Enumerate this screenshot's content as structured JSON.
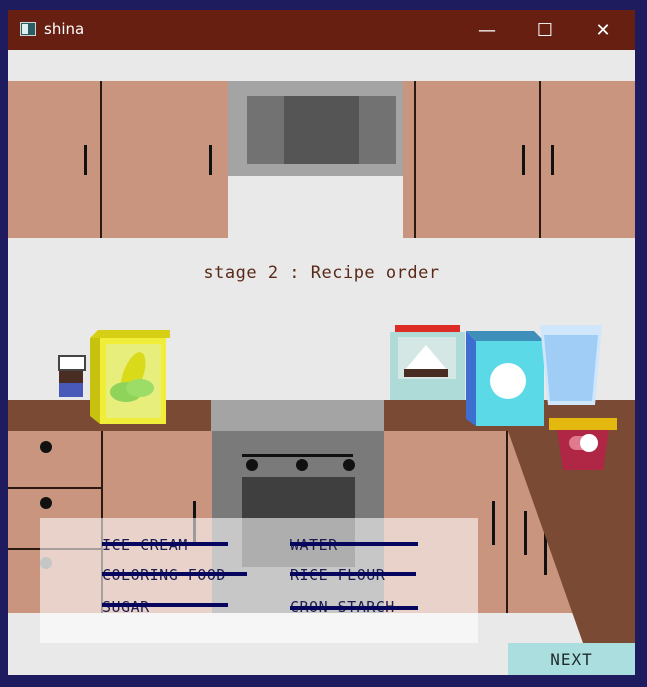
{
  "window": {
    "title": "shina",
    "controls": {
      "minimize": "—",
      "maximize": "☐",
      "close": "✕"
    }
  },
  "stage_label": "stage 2 : Recipe order",
  "recipe": {
    "items": [
      {
        "label": "ICE CREAM",
        "crossed": true
      },
      {
        "label": "WATER",
        "crossed": true
      },
      {
        "label": "COLORING FOOD",
        "crossed": true
      },
      {
        "label": "RICE FLOUR",
        "crossed": true
      },
      {
        "label": "SUGAR",
        "crossed": true
      },
      {
        "label": "CRON STARCH",
        "crossed": true
      }
    ]
  },
  "next_button": "NEXT",
  "colors": {
    "titlebar": "#661f11",
    "cabinet": "#c9957e",
    "countertop": "#7a4a34",
    "wall": "#e9e9e9",
    "strike": "#06065e"
  },
  "icons": [
    "app-window-icon",
    "corn-box-icon",
    "jar-icon",
    "flour-container-icon",
    "sugar-box-icon",
    "water-glass-icon",
    "coloring-bowl-icon"
  ]
}
